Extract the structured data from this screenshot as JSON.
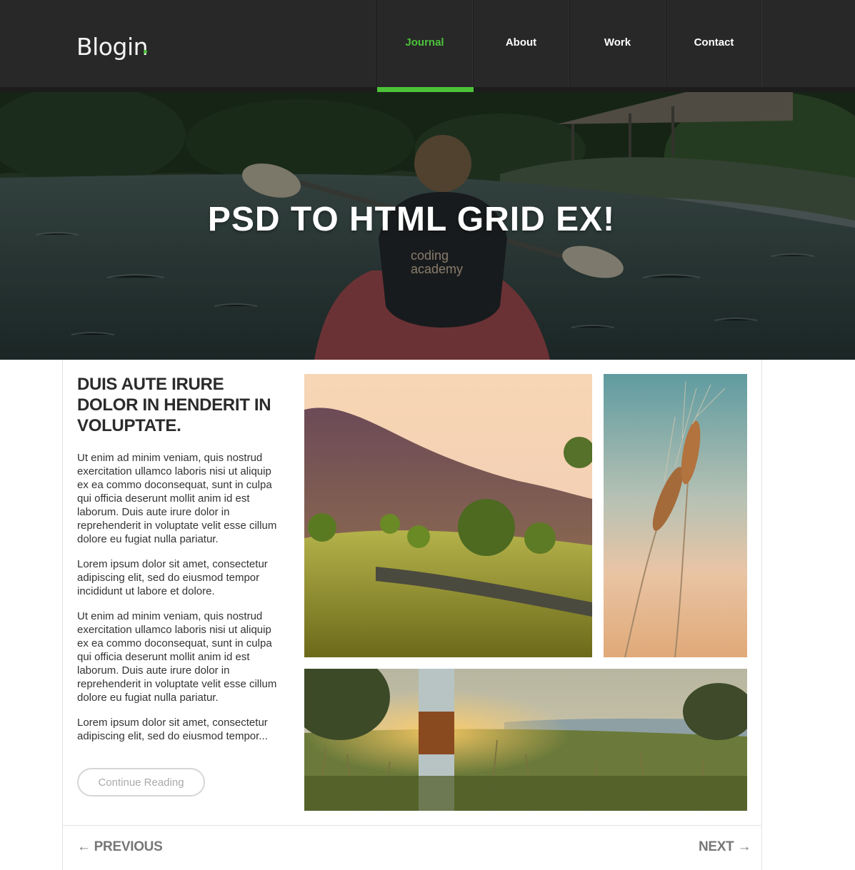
{
  "brand": {
    "name": "Blogin",
    "accent_color": "#4cc33a"
  },
  "nav": {
    "items": [
      {
        "label": "Journal",
        "active": true
      },
      {
        "label": "About",
        "active": false
      },
      {
        "label": "Work",
        "active": false
      },
      {
        "label": "Contact",
        "active": false
      }
    ]
  },
  "hero": {
    "title": "PSD TO HTML GRID EX!"
  },
  "article": {
    "title": "DUIS AUTE IRURE DOLOR IN HENDERIT IN VOLUPTATE.",
    "paragraphs": [
      "Ut enim ad minim veniam, quis nostrud exercitation ullamco laboris nisi ut aliquip ex ea commo doconsequat, sunt in culpa qui officia deserunt mollit anim id est laborum. Duis aute irure dolor in reprehenderit in voluptate velit esse cillum dolore eu fugiat nulla pariatur.",
      "Lorem ipsum dolor sit amet, consectetur adipiscing elit, sed do eiusmod tempor incididunt ut labore et dolore.",
      "Ut enim ad minim veniam, quis nostrud exercitation ullamco laboris nisi ut aliquip ex ea commo doconsequat, sunt in culpa qui officia deserunt mollit anim id est laborum. Duis aute irure dolor in reprehenderit in voluptate velit esse cillum dolore eu fugiat nulla pariatur.",
      "Lorem ipsum dolor sit amet, consectetur adipiscing elit, sed do eiusmod tempor..."
    ],
    "continue_label": "Continue Reading"
  },
  "pagination": {
    "previous_label": "← PREVIOUS",
    "next_label": "NEXT →"
  }
}
